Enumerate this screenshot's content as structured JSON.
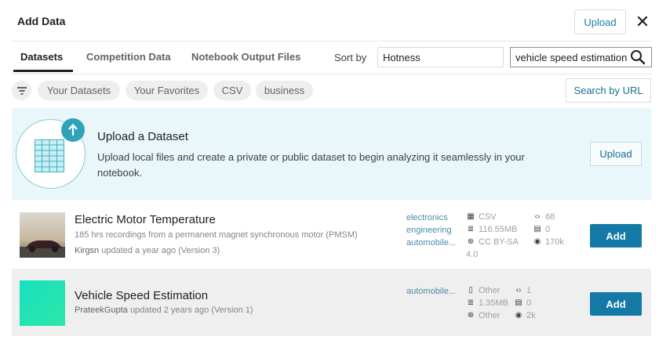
{
  "header": {
    "title": "Add Data",
    "upload_label": "Upload",
    "close_glyph": "✕"
  },
  "tabs": [
    {
      "label": "Datasets",
      "active": true
    },
    {
      "label": "Competition Data",
      "active": false
    },
    {
      "label": "Notebook Output Files",
      "active": false
    }
  ],
  "sort": {
    "label": "Sort by",
    "value": "Hotness"
  },
  "search": {
    "value": "vehicle speed estimation"
  },
  "filters": {
    "chips": [
      "Your Datasets",
      "Your Favorites",
      "CSV",
      "business"
    ],
    "search_by_url": "Search by URL"
  },
  "upload_banner": {
    "title": "Upload a Dataset",
    "description": "Upload local files and create a private or public dataset to begin analyzing it seamlessly in your notebook.",
    "button": "Upload"
  },
  "datasets": [
    {
      "title": "Electric Motor Temperature",
      "subtitle": "185 hrs recordings from a permanent magnet synchronous motor (PMSM)",
      "author": "Kirgsn",
      "updated": "updated a year ago (Version 3)",
      "tags": [
        "electronics",
        "engineering",
        "automobile..."
      ],
      "format": "CSV",
      "size": "116.55MB",
      "license": "CC BY-SA",
      "license_version": "4.0",
      "code": "68",
      "comments": "0",
      "views": "170k",
      "add_label": "Add"
    },
    {
      "title": "Vehicle Speed Estimation",
      "author": "PrateekGupta",
      "updated": "updated 2 years ago (Version 1)",
      "tags": [
        "automobile..."
      ],
      "format": "Other",
      "size": "1.35MB",
      "license": "Other",
      "code": "1",
      "comments": "0",
      "views": "2k",
      "add_label": "Add"
    }
  ],
  "colors": {
    "accent": "#1479a6",
    "banner_bg": "#e9f6fa",
    "tag": "#4a8da4",
    "teal_icon": "#31a3b8"
  }
}
